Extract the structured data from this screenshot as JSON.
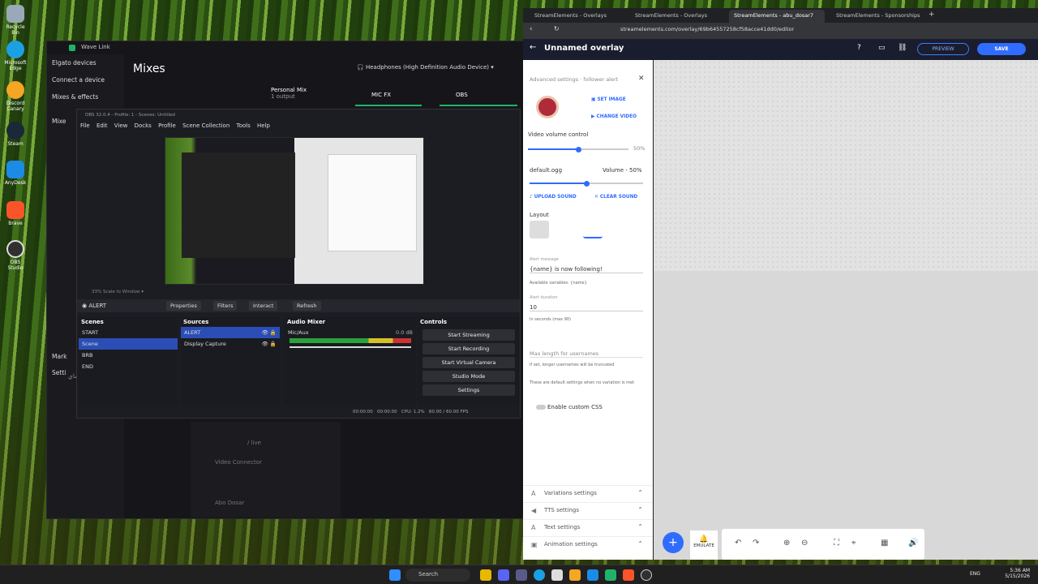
{
  "desktop_icons": [
    {
      "label": "Recycle Bin",
      "color": "#9aa9b8"
    },
    {
      "label": "Microsoft Edge",
      "color": "#1ba1e2"
    },
    {
      "label": "Discord Canary",
      "color": "#f5a623"
    },
    {
      "label": "Steam",
      "color": "#1b2838"
    },
    {
      "label": "AnyDesk",
      "color": "#1c8be6"
    },
    {
      "label": "Brave",
      "color": "#fb542b"
    },
    {
      "label": "OBS Studio",
      "color": "#303030"
    }
  ],
  "wavelink": {
    "title": "Wave Link",
    "side": [
      "Elgato devices",
      "Connect a device",
      "Mixes & effects"
    ],
    "main_title": "Mixes",
    "device": "Headphones (High Definition Audio Device)",
    "mixes": [
      {
        "label": "Personal Mix",
        "sub": "1 output"
      },
      {
        "label": "MIC FX",
        "sub": ""
      },
      {
        "label": "OBS",
        "sub": ""
      }
    ],
    "side_truncated": [
      "Mixe",
      "Mark",
      "Setti"
    ],
    "arabic_text": "يلزلز ماجاه شاي",
    "faded": [
      "/ live",
      "Video Connector",
      "Abo Dosar"
    ]
  },
  "obs": {
    "title": "OBS 32.0.4 - Profile: 1 - Scenes: Untitled",
    "menu": [
      "File",
      "Edit",
      "View",
      "Docks",
      "Profile",
      "Scene Collection",
      "Tools",
      "Help"
    ],
    "zoom": "33%",
    "scale_label": "Scale to Window",
    "source_name": "ALERT",
    "bar_buttons": [
      "Properties",
      "Filters",
      "Interact",
      "Refresh"
    ],
    "scenes_header": "Scenes",
    "scenes": [
      "START",
      "Scene",
      "BRB",
      "END"
    ],
    "sources_header": "Sources",
    "sources": [
      "ALERT",
      "Display Capture"
    ],
    "mixer_header": "Audio Mixer",
    "mixer_channel": "Mic/Aux",
    "mixer_db": "0.0 dB",
    "controls_header": "Controls",
    "controls": [
      "Start Streaming",
      "Start Recording",
      "Start Virtual Camera",
      "Studio Mode",
      "Settings"
    ],
    "status": {
      "time1": "00:00:00",
      "time2": "00:00:00",
      "cpu": "CPU: 1.2%",
      "fps": "60.00 / 60.00 FPS"
    }
  },
  "browser": {
    "tabs": [
      "StreamElements - Overlays",
      "StreamElements - Overlays",
      "StreamElements - abu_dosar7",
      "StreamElements - Sponsorships"
    ],
    "url": "streamelements.com/overlay/69b64557258cf58acce41dd0/editor",
    "page_title": "Unnamed overlay",
    "preview_label": "PREVIEW",
    "save_label": "SAVE"
  },
  "panel": {
    "heading": "Advanced settings · follower alert",
    "set_image": "SET IMAGE",
    "change_video": "CHANGE VIDEO",
    "video_volume_label": "Video volume control",
    "video_volume_value": "50%",
    "video_volume": 0.5,
    "sound_file": "default.ogg",
    "sound_volume_label": "Volume - 50%",
    "sound_volume": 0.5,
    "upload_sound": "UPLOAD SOUND",
    "clear_sound": "CLEAR SOUND",
    "layout_label": "Layout",
    "alert_message_label": "Alert message",
    "alert_message": "{name} is now following!",
    "available_vars": "Available variables: {name}",
    "alert_duration_label": "Alert duration",
    "alert_duration": "10",
    "duration_hint": "In seconds (max 90)",
    "max_len_label": "Max length for usernames",
    "max_len_hint": "If set, longer usernames will be truncated",
    "default_note": "These are default settings when no variation is met",
    "custom_css_label": "Enable custom CSS",
    "accordions": [
      "Variations settings",
      "TTS settings",
      "Text settings",
      "Animation settings"
    ],
    "emulate_label": "EMULATE"
  },
  "taskbar": {
    "search": "Search",
    "lang": "ENG",
    "time": "5:36 AM",
    "date": "5/15/2026"
  }
}
